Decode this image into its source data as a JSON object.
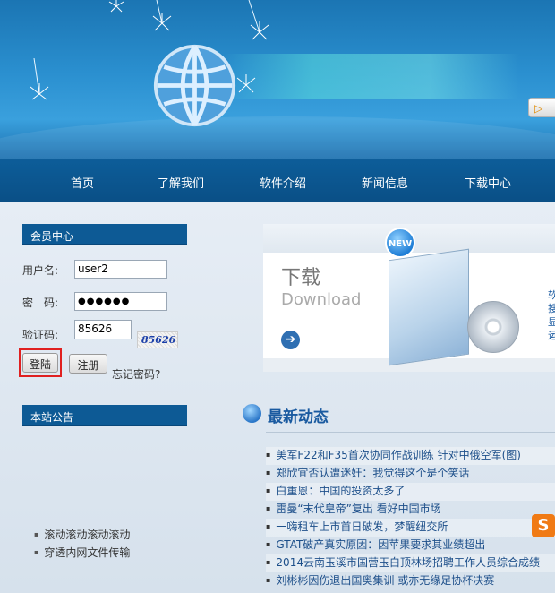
{
  "nav": {
    "items": [
      "首页",
      "了解我们",
      "软件介绍",
      "新闻信息",
      "下载中心"
    ]
  },
  "member": {
    "title": "会员中心",
    "username_label": "用户名:",
    "username_value": "user2",
    "password_label": "密　码:",
    "password_value": "●●●●●●",
    "captcha_label": "验证码:",
    "captcha_value": "85626",
    "captcha_image_text": "85626",
    "login_label": "登陆",
    "register_label": "注册",
    "forgot_label": "忘记密码?"
  },
  "notice": {
    "title": "本站公告",
    "items": [
      "滚动滚动滚动滚动",
      "穿透内网文件传输"
    ]
  },
  "download": {
    "title": "下载",
    "subtitle": "Download",
    "badge": "NEW",
    "side_text": "软搜显运"
  },
  "news": {
    "title": "最新动态",
    "items": [
      "美军F22和F35首次协同作战训练 针对中俄空军(图)",
      "郑欣宜否认遭迷奸：我觉得这个是个笑话",
      "白重恩：中国的投资太多了",
      "雷曼“末代皇帝”复出 看好中国市场",
      "一嗨租车上市首日破发，梦醒纽交所",
      "GTAT破产真实原因：因苹果要求其业绩超出",
      "2014云南玉溪市国营玉白顶林场招聘工作人员综合成绩",
      "刘彬彬因伤退出国奥集训 或亦无缘足协杯决赛"
    ]
  },
  "colors": {
    "nav_bg": "#0d5d99",
    "side_header_bg": "#0d5a95",
    "news_title": "#1a5aa0",
    "login_highlight": "#e02020"
  }
}
